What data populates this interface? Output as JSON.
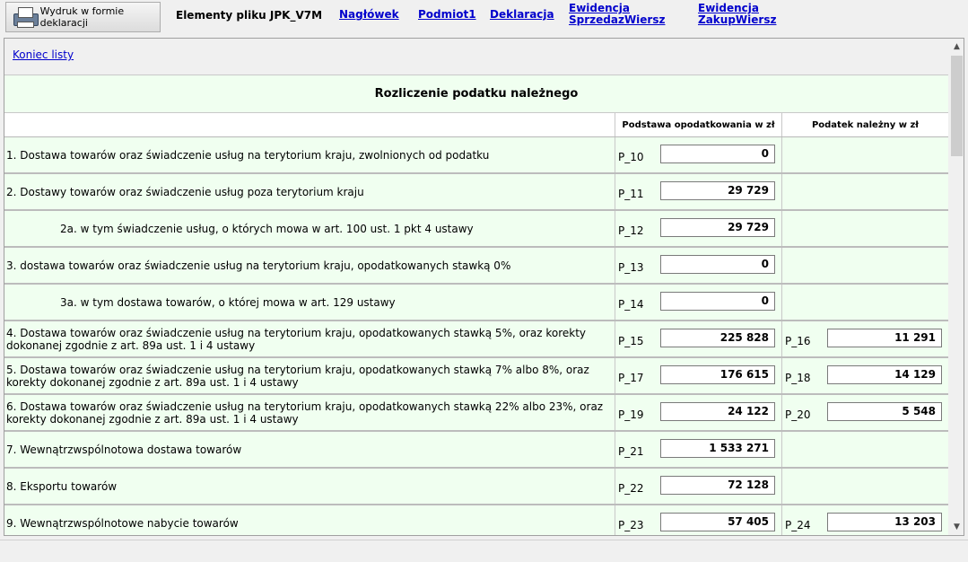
{
  "toolbar": {
    "print_label": "Wydruk w formie deklaracji",
    "title": "Elementy pliku JPK_V7M",
    "links": {
      "naglowek": "Nagłówek",
      "podmiot": "Podmiot1",
      "deklaracja": "Deklaracja",
      "sprzedaz_l1": "Ewidencja",
      "sprzedaz_l2": "SprzedazWiersz",
      "zakup_l1": "Ewidencja",
      "zakup_l2": "ZakupWiersz"
    }
  },
  "content": {
    "end_link": "Koniec listy",
    "section_title": "Rozliczenie podatku należnego",
    "col_base": "Podstawa opodatkowania w zł",
    "col_tax": "Podatek należny w zł",
    "rows": [
      {
        "desc": "1. Dostawa towarów oraz świadczenie usług na terytorium kraju, zwolnionych od podatku",
        "code1": "P_10",
        "val1": "0"
      },
      {
        "desc": "2. Dostawy towarów oraz świadczenie usług poza terytorium kraju",
        "code1": "P_11",
        "val1": "29 729"
      },
      {
        "desc": "2a. w tym świadczenie usług, o których mowa w art. 100 ust. 1 pkt 4 ustawy",
        "code1": "P_12",
        "val1": "29 729"
      },
      {
        "desc": "3. dostawa towarów oraz świadczenie usług na terytorium kraju, opodatkowanych stawką 0%",
        "code1": "P_13",
        "val1": "0"
      },
      {
        "desc": "3a. w tym dostawa towarów, o której mowa w art. 129 ustawy",
        "code1": "P_14",
        "val1": "0"
      },
      {
        "desc": "4. Dostawa towarów oraz świadczenie usług na terytorium kraju, opodatkowanych stawką 5%, oraz korekty dokonanej zgodnie z art. 89a ust. 1 i 4 ustawy",
        "code1": "P_15",
        "val1": "225 828",
        "code2": "P_16",
        "val2": "11 291"
      },
      {
        "desc": "5. Dostawa towarów oraz świadczenie usług na terytorium kraju, opodatkowanych stawką 7% albo 8%, oraz korekty dokonanej zgodnie z art. 89a ust. 1 i 4 ustawy",
        "code1": "P_17",
        "val1": "176 615",
        "code2": "P_18",
        "val2": "14 129"
      },
      {
        "desc": "6. Dostawa towarów oraz świadczenie usług na terytorium kraju, opodatkowanych stawką 22% albo 23%, oraz korekty dokonanej zgodnie z art. 89a ust. 1 i 4 ustawy",
        "code1": "P_19",
        "val1": "24 122",
        "code2": "P_20",
        "val2": "5 548"
      },
      {
        "desc": "7. Wewnątrzwspólnotowa dostawa towarów",
        "code1": "P_21",
        "val1": "1 533 271"
      },
      {
        "desc": "8. Eksportu towarów",
        "code1": "P_22",
        "val1": "72 128"
      },
      {
        "desc": "9. Wewnątrzwspólnotowe nabycie towarów",
        "code1": "P_23",
        "val1": "57 405",
        "code2": "P_24",
        "val2": "13 203"
      }
    ]
  },
  "icons": {
    "print": "printer-icon",
    "scroll_up": "scroll-up-arrow-icon",
    "scroll_down": "scroll-down-arrow-icon"
  },
  "colors": {
    "row_background": "#f0fff0",
    "link": "#0000cc"
  }
}
